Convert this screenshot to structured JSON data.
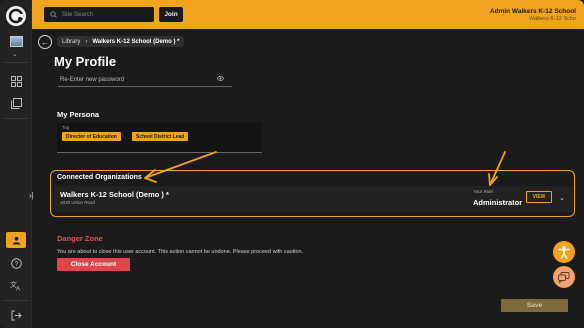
{
  "header": {
    "search_placeholder": "Site Search",
    "join_label": "Join",
    "user_name": "Admin Walkers K-12 School",
    "user_org": "Walkers K-12 Scho"
  },
  "breadcrumb": {
    "root": "Library",
    "separator": "›",
    "current": "Walkers K-12 School (Demo ) *"
  },
  "page": {
    "title": "My Profile"
  },
  "password": {
    "label": "Re-Enter new password"
  },
  "persona": {
    "title": "My Persona",
    "tag_label": "Tag",
    "tags": [
      "Director of Education",
      "School District Lead"
    ]
  },
  "connected_orgs": {
    "title": "Connected Organizations",
    "org_name": "Walkers K-12 School (Demo ) *",
    "org_address": "4839 Union Road",
    "role_label": "Your Role:",
    "role_value": "Administrator",
    "view_label": "VIEW"
  },
  "danger": {
    "title": "Danger Zone",
    "text": "You are about to close this user account. This action cannot be undone. Please proceed with caution.",
    "close_label": "Close Account"
  },
  "footer": {
    "save_label": "Save"
  },
  "colors": {
    "accent": "#f0a31f",
    "danger": "#e0454c",
    "background": "#1b1b1b",
    "annotation": "#f0a31f"
  },
  "icons": {
    "sidebar": [
      "app-logo-icon",
      "dashboard-icon",
      "library-icon",
      "expand-icon",
      "profile-icon",
      "help-icon",
      "translate-icon",
      "logout-icon"
    ],
    "floating": [
      "accessibility-icon",
      "chat-icon"
    ]
  }
}
